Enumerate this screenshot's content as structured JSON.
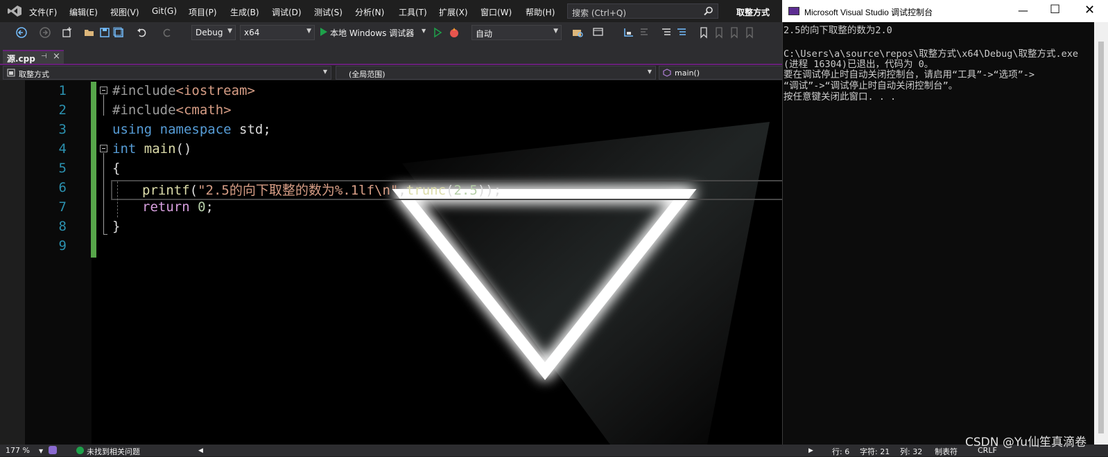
{
  "menubar": {
    "items": [
      "文件(F)",
      "编辑(E)",
      "视图(V)",
      "Git(G)",
      "项目(P)",
      "生成(B)",
      "调试(D)",
      "测试(S)",
      "分析(N)",
      "工具(T)",
      "扩展(X)",
      "窗口(W)",
      "帮助(H)"
    ],
    "search_placeholder": "搜索 (Ctrl+Q)",
    "project_name": "取整方式"
  },
  "toolbar": {
    "config": "Debug",
    "platform": "x64",
    "run_label": "本地 Windows 调试器",
    "auto": "自动"
  },
  "tab": {
    "label": "源.cpp",
    "pin": "⊣",
    "close": "×"
  },
  "navbar": {
    "project": "取整方式",
    "scope": "(全局范围)",
    "function": "main()"
  },
  "editor": {
    "line_numbers": [
      "1",
      "2",
      "3",
      "4",
      "5",
      "6",
      "7",
      "8",
      "9"
    ],
    "lines": {
      "l1_pp": "#include",
      "l1_inc": "<iostream>",
      "l2_pp": "#include",
      "l2_inc": "<cmath>",
      "l3_kw1": "using",
      "l3_kw2": "namespace",
      "l3_rest": " std;",
      "l4_kw": "int",
      "l4_fn": "main",
      "l4_rest": "()",
      "l5": "{",
      "l6_fn": "printf",
      "l6_p1": "(",
      "l6_str": "\"2.5的向下取整的数为%.1lf\\n\"",
      "l6_p2": ",",
      "l6_fn2": "trunc",
      "l6_p3": "(",
      "l6_num": "2.5",
      "l6_p4": "));",
      "l7_kw": "return",
      "l7_num": "0",
      "l7_rest": ";",
      "l8": "}"
    }
  },
  "console": {
    "title": "Microsoft Visual Studio 调试控制台",
    "lines": [
      "2.5的向下取整的数为2.0",
      "",
      "C:\\Users\\a\\source\\repos\\取整方式\\x64\\Debug\\取整方式.exe",
      "(进程 16304)已退出，代码为 0。",
      "要在调试停止时自动关闭控制台，请启用“工具”->“选项”->",
      "“调试”->“调试停止时自动关闭控制台”。",
      "按任意键关闭此窗口. . ."
    ]
  },
  "status": {
    "zoom": "177 %",
    "issues": "未找到相关问题",
    "row": "行: 6",
    "char": "字符: 21",
    "col": "列: 32",
    "tabs": "制表符",
    "eol": "CRLF"
  },
  "watermark": "CSDN @Yu仙笙真滴卷"
}
